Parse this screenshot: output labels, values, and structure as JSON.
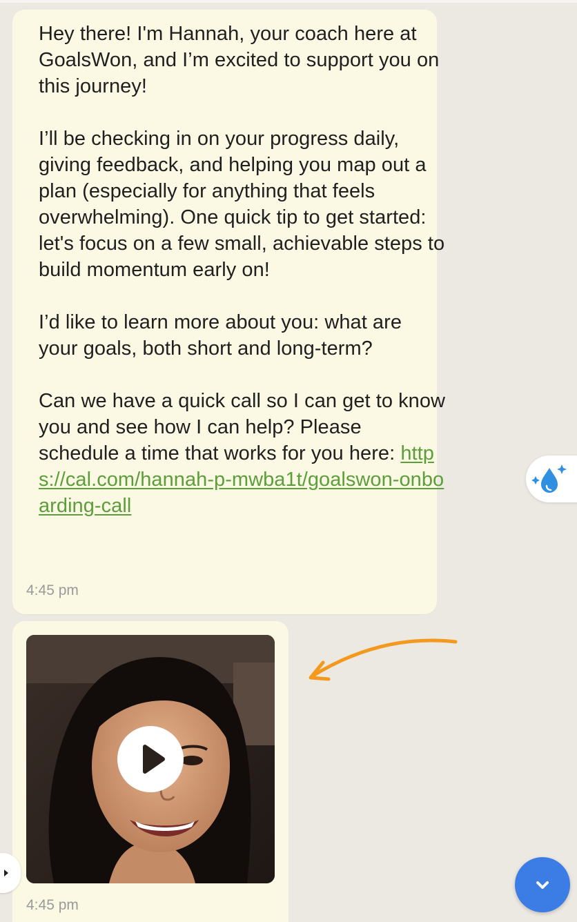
{
  "chat": {
    "message1": {
      "paragraph1": "Hey there! I'm Hannah, your coach here at GoalsWon, and I’m excited to support you on this journey!",
      "paragraph2": "I’ll be checking in on your progress daily, giving feedback, and helping you map out a plan (especially for anything that feels overwhelming). One quick tip to get started: let's focus on a few small, achievable steps to build momentum early on!",
      "paragraph3": "I’d like to learn more about you: what are your goals, both short and long-term?",
      "paragraph4_prefix": "Can we have a quick call so I can get to know you and see how I can help? Please schedule a time that works for you here: ",
      "link": "https://cal.com/hannah-p-mwba1t/goalswon-onboarding-call",
      "time": "4:45 pm"
    },
    "message2": {
      "time": "4:45 pm"
    }
  },
  "colors": {
    "chat_background": "#ece8e2",
    "bubble_background": "#fbf8e4",
    "link": "#5b9e3a",
    "annotation_arrow": "#f39a1e",
    "scroll_button": "#3b7de4",
    "sparkle_icon": "#2f8fe0"
  },
  "icons": {
    "play": "play-icon",
    "sparkle": "sparkle-water-drop-icon",
    "scroll_down": "chevron-down-icon",
    "expand": "chevron-right-icon",
    "annotation": "curved-arrow-icon"
  }
}
